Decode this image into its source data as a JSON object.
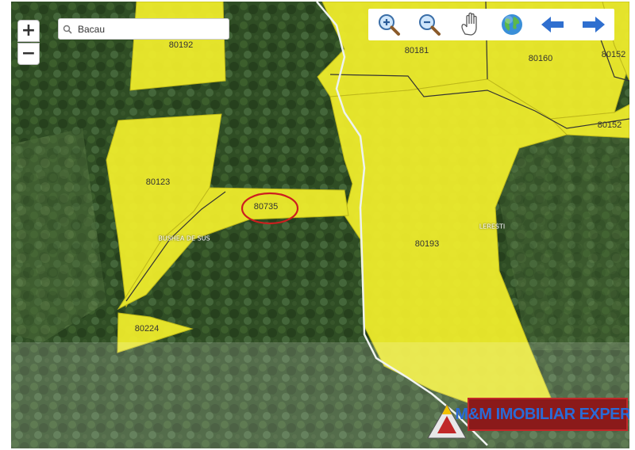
{
  "search": {
    "value": "Bacau"
  },
  "zoom": {
    "in_label": "+",
    "out_label": "−"
  },
  "toolbar": {
    "tools": [
      {
        "icon": "zoom-in-icon"
      },
      {
        "icon": "zoom-out-icon"
      },
      {
        "icon": "hand-pan-icon"
      },
      {
        "icon": "globe-icon"
      },
      {
        "icon": "arrow-left-icon"
      },
      {
        "icon": "arrow-right-icon"
      }
    ]
  },
  "parcels": [
    {
      "id": "80192",
      "label": "80192"
    },
    {
      "id": "80181",
      "label": "80181"
    },
    {
      "id": "80160",
      "label": "80160"
    },
    {
      "id": "80152a",
      "label": "80152"
    },
    {
      "id": "80152b",
      "label": "80152"
    },
    {
      "id": "80123",
      "label": "80123"
    },
    {
      "id": "80735",
      "label": "80735"
    },
    {
      "id": "80193",
      "label": "80193"
    },
    {
      "id": "80224",
      "label": "80224"
    }
  ],
  "places": [
    {
      "label": "BUSHEA DE SUS"
    },
    {
      "label": "LERESTI"
    }
  ],
  "highlight": {
    "parcel": "80735",
    "color": "#cc1f1f"
  },
  "colors": {
    "parcel_fill": "#f2ef2c",
    "forest_dark": "#2d4a22",
    "forest_light": "#5b7a3f",
    "road": "#e8ece8"
  },
  "watermark": {
    "text": "M&M IMOBILIAR EXPERT"
  }
}
